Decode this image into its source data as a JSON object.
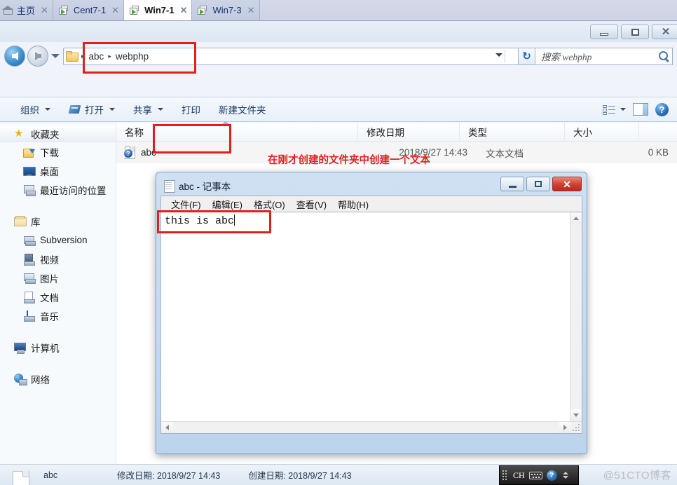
{
  "vm_tabs": {
    "tabs": [
      {
        "label": "主页",
        "icon": "home-icon",
        "active": false,
        "closable": true
      },
      {
        "label": "Cent7-1",
        "icon": "vm-icon",
        "active": false,
        "closable": true
      },
      {
        "label": "Win7-1",
        "icon": "vm-icon",
        "active": true,
        "closable": true
      },
      {
        "label": "Win7-3",
        "icon": "vm-icon",
        "active": false,
        "closable": true
      }
    ],
    "close_glyph": "✕"
  },
  "explorer": {
    "window_controls": {
      "minimize": "minimize-icon",
      "maximize": "maximize-icon",
      "close": "✕"
    },
    "nav": {
      "back": "back-arrow-icon",
      "forward": "forward-arrow-icon",
      "history_dropdown": "chevron-down-icon",
      "breadcrumb": [
        "abc",
        "webphp"
      ],
      "separator": "▸",
      "refresh_glyph": "↻"
    },
    "search": {
      "placeholder": "搜索 webphp",
      "icon": "search-icon"
    },
    "commandbar": {
      "items": [
        {
          "label": "组织",
          "has_caret": true,
          "icon": null
        },
        {
          "label": "打开",
          "has_caret": true,
          "icon": "open-icon"
        },
        {
          "label": "共享",
          "has_caret": true,
          "icon": null
        },
        {
          "label": "打印",
          "has_caret": false,
          "icon": null
        },
        {
          "label": "新建文件夹",
          "has_caret": false,
          "icon": null
        }
      ],
      "right_icons": [
        "view-layout-icon",
        "preview-pane-icon",
        "help-icon"
      ],
      "help_glyph": "?"
    },
    "sidebar": {
      "groups": [
        {
          "header": {
            "label": "收藏夹",
            "icon": "star-icon"
          },
          "items": [
            {
              "label": "下载",
              "icon": "downloads-icon"
            },
            {
              "label": "桌面",
              "icon": "desktop-icon"
            },
            {
              "label": "最近访问的位置",
              "icon": "recent-places-icon"
            }
          ]
        },
        {
          "header": {
            "label": "库",
            "icon": "library-icon"
          },
          "items": [
            {
              "label": "Subversion",
              "icon": "subversion-icon"
            },
            {
              "label": "视频",
              "icon": "videos-icon"
            },
            {
              "label": "图片",
              "icon": "pictures-icon"
            },
            {
              "label": "文档",
              "icon": "documents-icon"
            },
            {
              "label": "音乐",
              "icon": "music-icon"
            }
          ]
        },
        {
          "header": {
            "label": "计算机",
            "icon": "computer-icon"
          },
          "items": []
        },
        {
          "header": {
            "label": "网络",
            "icon": "network-icon"
          },
          "items": []
        }
      ]
    },
    "filelist": {
      "columns": [
        "名称",
        "修改日期",
        "类型",
        "大小"
      ],
      "sort_column": "名称",
      "sort_direction": "asc",
      "rows": [
        {
          "name": "abc",
          "modified": "2018/9/27 14:43",
          "type": "文本文档",
          "size": "0 KB",
          "icon": "text-file-icon",
          "badge": "?"
        }
      ]
    },
    "statusbar": {
      "name": "abc",
      "modified_label": "修改日期: 2018/9/27 14:43",
      "created_label": "创建日期: 2018/9/27 14:43",
      "icon": "text-file-icon"
    }
  },
  "notepad": {
    "title": "abc - 记事本",
    "icon": "notepad-icon",
    "window_controls": {
      "minimize": "minimize-icon",
      "maximize": "maximize-icon",
      "close": "✕"
    },
    "menu": [
      "文件(F)",
      "编辑(E)",
      "格式(O)",
      "查看(V)",
      "帮助(H)"
    ],
    "text": "this is abc",
    "scrollbars": {
      "vertical": "vertical-scrollbar",
      "horizontal": "horizontal-scrollbar"
    }
  },
  "annotations": {
    "note_text": "在刚才创建的文件夹中创建一个文本",
    "accent_color": "#e01f1f",
    "boxes": [
      "breadcrumb-highlight",
      "file-row-highlight",
      "notepad-text-highlight"
    ]
  },
  "ime": {
    "language": "CH",
    "keyboard_icon": "keyboard-icon",
    "help_icon": "help-icon",
    "expand_icon": "expand-icon"
  },
  "watermark": "@51CTO博客"
}
